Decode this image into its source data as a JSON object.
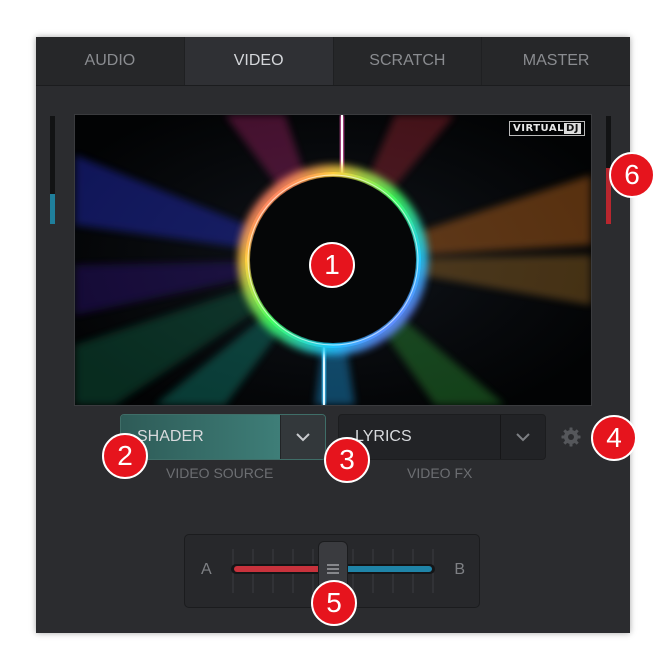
{
  "tabs": [
    {
      "label": "AUDIO",
      "active": false
    },
    {
      "label": "VIDEO",
      "active": true
    },
    {
      "label": "SCRATCH",
      "active": false
    },
    {
      "label": "MASTER",
      "active": false
    }
  ],
  "video_preview": {
    "logo_text": "VIRTUAL",
    "logo_text_accent": "DJ"
  },
  "video_source": {
    "value": "SHADER",
    "caption": "VIDEO SOURCE"
  },
  "video_fx": {
    "value": "LYRICS",
    "caption": "VIDEO FX"
  },
  "settings": {
    "icon": "gear-icon"
  },
  "crossfader": {
    "left_label": "A",
    "right_label": "B",
    "position": 0.5,
    "left_color": "#c8323c",
    "right_color": "#1f84a8"
  },
  "meters": {
    "left_level": 0.28,
    "right_level": 0.52,
    "left_color": "#1f7f9c",
    "right_color": "#b8262e"
  },
  "callouts": [
    "1",
    "2",
    "3",
    "4",
    "5",
    "6"
  ],
  "colors": {
    "accent": "#e6141d",
    "panel": "#2b2c2f",
    "source_selected": "#3e7e78"
  }
}
